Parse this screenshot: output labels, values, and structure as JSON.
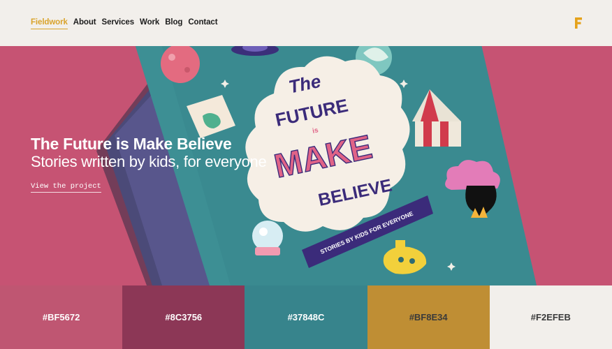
{
  "nav": {
    "items": [
      {
        "label": "Fieldwork",
        "active": true
      },
      {
        "label": "About"
      },
      {
        "label": "Services"
      },
      {
        "label": "Work"
      },
      {
        "label": "Blog"
      },
      {
        "label": "Contact"
      }
    ]
  },
  "logo": {
    "icon": "f-monogram-icon",
    "color": "#E5A21A"
  },
  "hero": {
    "title": "The Future is Make Believe",
    "subtitle": "Stories written by kids, for everyone",
    "link_label": "View the project",
    "book": {
      "cover_lines": [
        "The",
        "FUTURE",
        "is",
        "MAKE",
        "BELIEVE"
      ],
      "banner": "STORIES BY KIDS FOR EVERYONE"
    }
  },
  "swatches": [
    {
      "hex": "#BF5672",
      "text_color": "#ffffff"
    },
    {
      "hex": "#8C3756",
      "text_color": "#ffffff"
    },
    {
      "hex": "#37848C",
      "text_color": "#ffffff"
    },
    {
      "hex": "#BF8E34",
      "text_color": "#3a3a3a"
    },
    {
      "hex": "#F2EFEB",
      "text_color": "#3a3a3a"
    }
  ]
}
